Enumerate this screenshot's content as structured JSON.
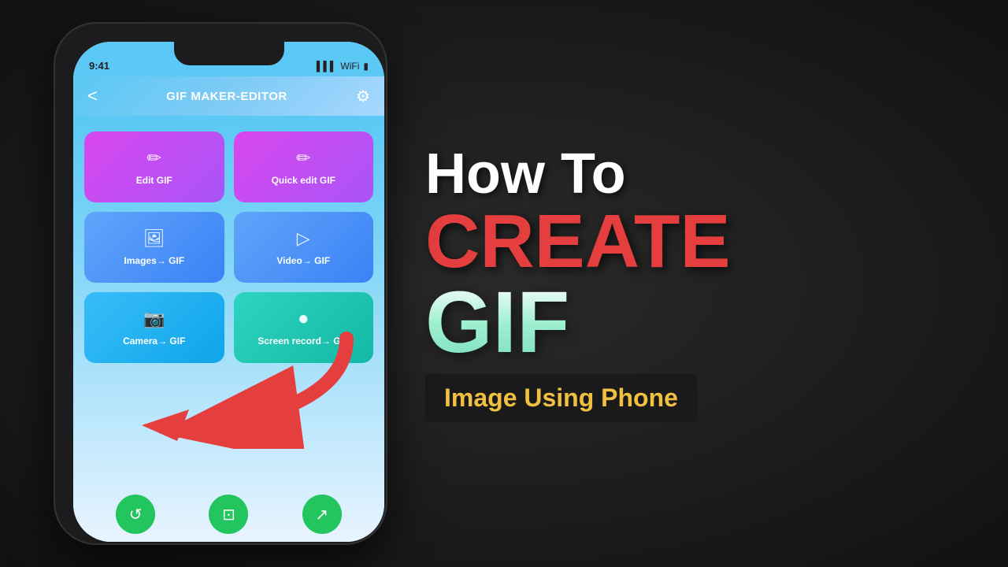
{
  "scene": {
    "background_color": "#1a1a1a"
  },
  "phone": {
    "status_bar": {
      "time": "9:41",
      "signal_icon": "▌▌▌",
      "wifi_icon": "WiFi",
      "battery_icon": "🔋"
    },
    "header": {
      "back_icon": "<",
      "title": "GIF MAKER-EDITOR",
      "settings_icon": "⚙"
    },
    "buttons": [
      {
        "row": 0,
        "id": "edit-gif",
        "icon": "✏",
        "label": "Edit GIF",
        "color_class": "btn-purple"
      },
      {
        "row": 0,
        "id": "quick-edit-gif",
        "icon": "✏",
        "label": "Quick edit GIF",
        "color_class": "btn-purple"
      },
      {
        "row": 1,
        "id": "images-to-gif",
        "icon": "🖼",
        "label": "Images→ GIF",
        "color_class": "btn-blue-light"
      },
      {
        "row": 1,
        "id": "video-to-gif",
        "icon": "▷",
        "label": "Video→ GIF",
        "color_class": "btn-blue-light"
      },
      {
        "row": 2,
        "id": "camera-to-gif",
        "icon": "📷",
        "label": "Camera→ GIF",
        "color_class": "btn-blue-medium"
      },
      {
        "row": 2,
        "id": "screen-record-to-gif",
        "icon": "⏺",
        "label": "Screen record→ GIF",
        "color_class": "btn-teal"
      }
    ],
    "bottom_nav": [
      {
        "id": "nav-history",
        "icon": "↺"
      },
      {
        "id": "nav-crop",
        "icon": "⊡"
      },
      {
        "id": "nav-share",
        "icon": "↗"
      }
    ]
  },
  "text_section": {
    "how_to": "How To",
    "create": "CREATE",
    "gif": "GIF",
    "subtitle": "Image Using Phone"
  }
}
